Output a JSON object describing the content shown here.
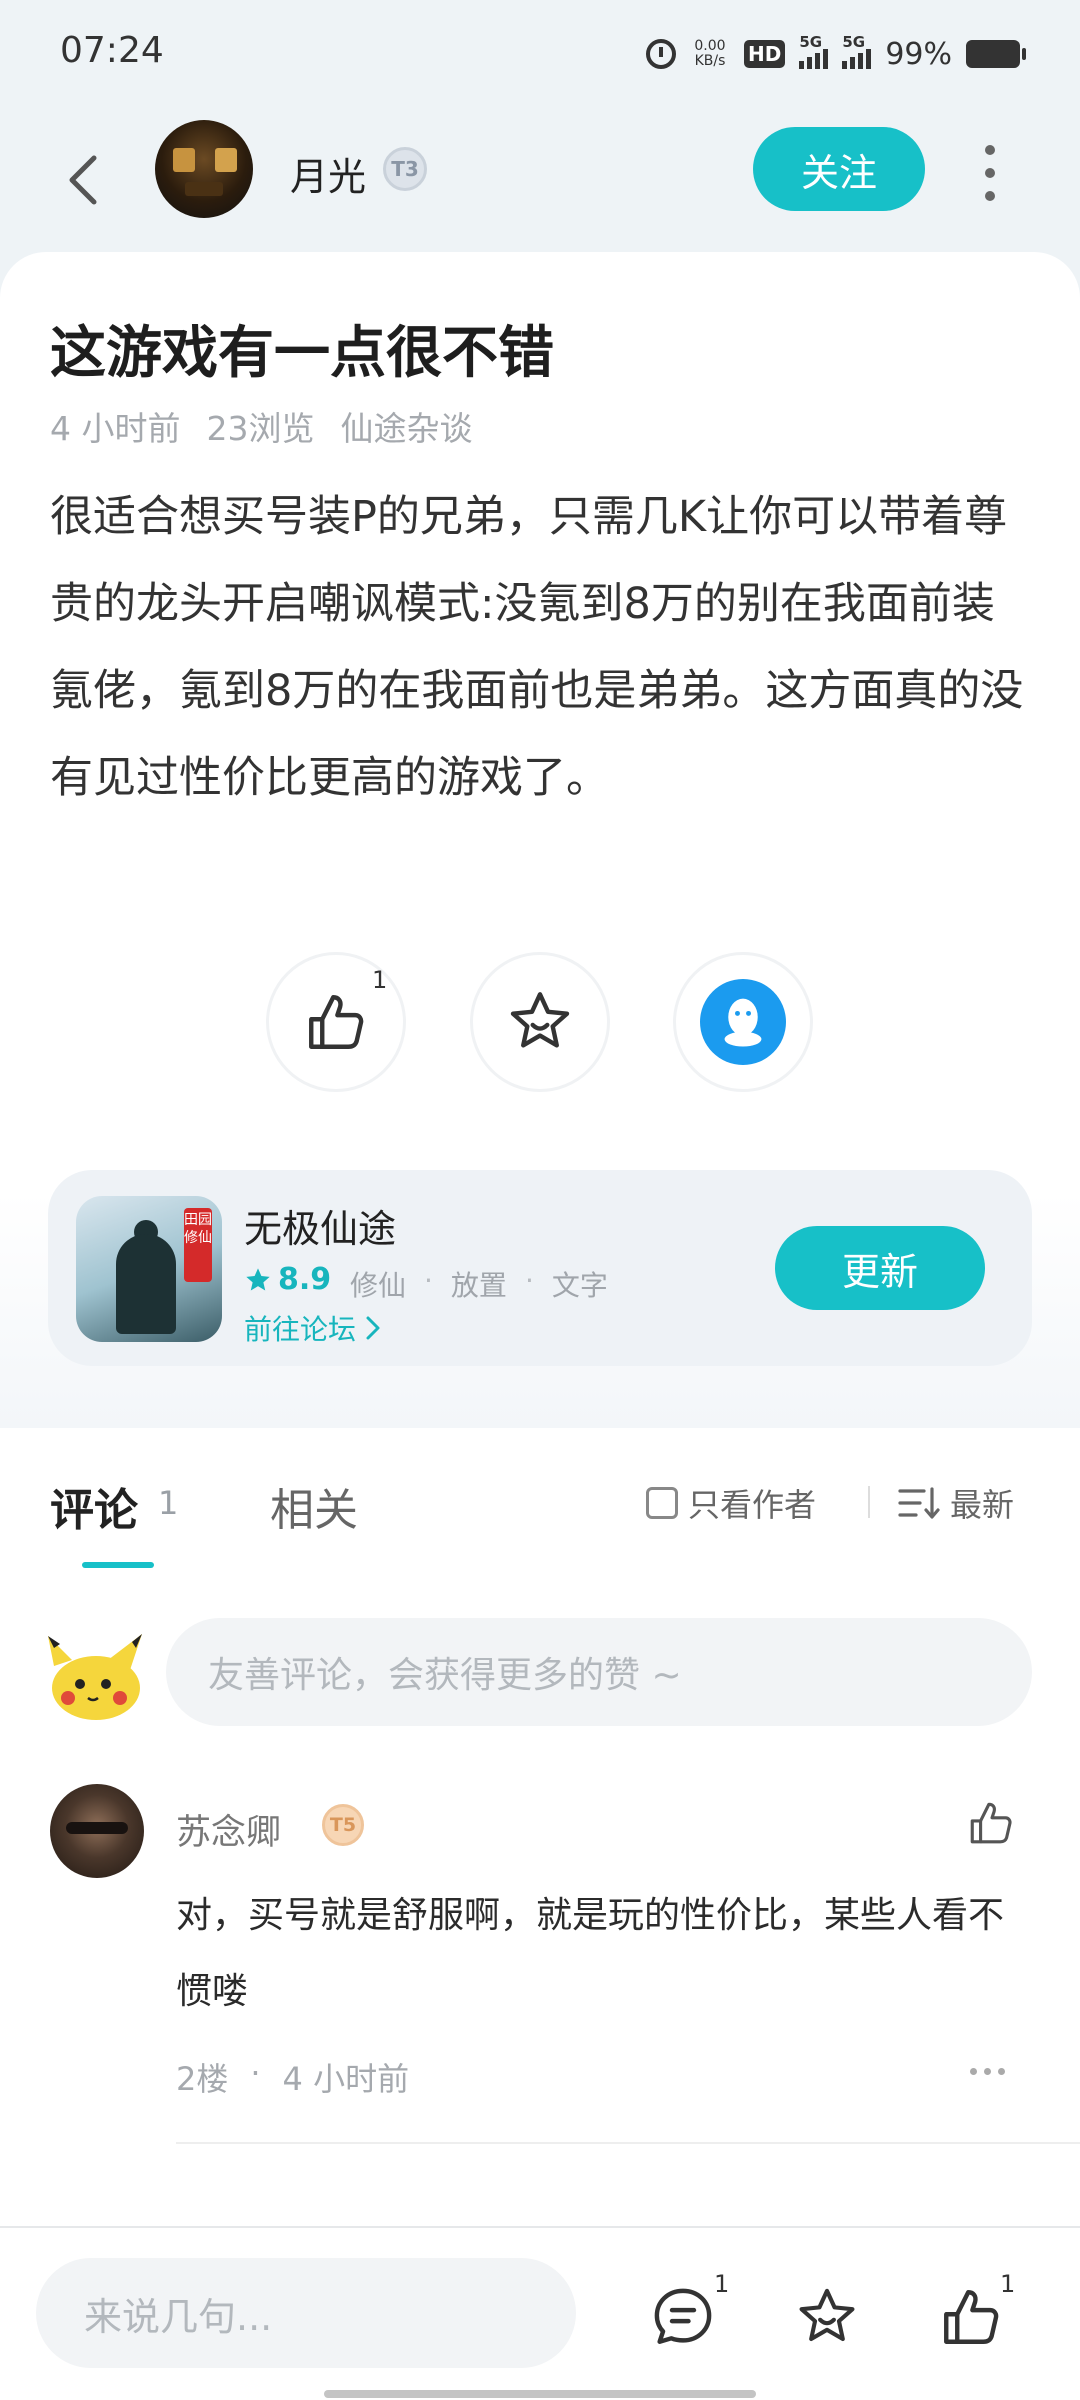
{
  "status_bar": {
    "time": "07:24",
    "net_speed_value": "0.00",
    "net_speed_unit": "KB/s",
    "hd_label": "HD",
    "signal1": "5G",
    "signal2": "5G",
    "battery": "99%"
  },
  "header": {
    "author_name": "月光",
    "author_level": "T3",
    "follow_label": "关注"
  },
  "post": {
    "title": "这游戏有一点很不错",
    "time_ago": "4 小时前",
    "views": "23浏览",
    "category": "仙途杂谈",
    "body": "很适合想买号装P的兄弟，只需几K让你可以带着尊贵的龙头开启嘲讽模式:没氪到8万的别在我面前装氪佬，氪到8万的在我面前也是弟弟。这方面真的没有见过性价比更高的游戏了。",
    "like_count": "1"
  },
  "game": {
    "name": "无极仙途",
    "icon_tag": "田园修仙",
    "rating": "8.9",
    "tags": [
      "修仙",
      "放置",
      "文字"
    ],
    "tag_separator": "·",
    "forum_link": "前往论坛",
    "update_label": "更新"
  },
  "comments_section": {
    "tab_comments": "评论",
    "tab_comments_count": "1",
    "tab_related": "相关",
    "only_author": "只看作者",
    "sort_label": "最新",
    "input_placeholder": "友善评论，会获得更多的赞 ~",
    "items": [
      {
        "user": "苏念卿",
        "level": "T5",
        "text": "对，买号就是舒服啊，就是玩的性价比，某些人看不惯喽",
        "floor": "2楼",
        "separator": "·",
        "time_ago": "4 小时前"
      }
    ]
  },
  "bottom_bar": {
    "reply_placeholder": "来说几句...",
    "comment_count": "1",
    "like_count": "1"
  },
  "colors": {
    "accent": "#17c0c8",
    "qq_blue": "#1b9bef"
  }
}
